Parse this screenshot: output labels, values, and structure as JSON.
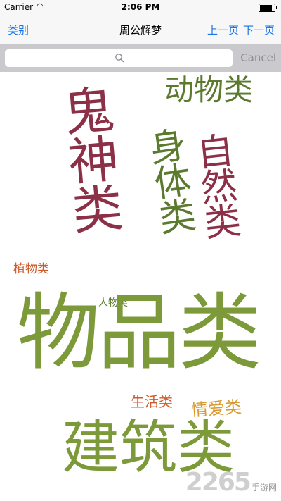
{
  "status": {
    "carrier": "Carrier",
    "time": "2:06 PM"
  },
  "navbar": {
    "left": "类别",
    "title": "周公解梦",
    "prev": "上一页",
    "next": "下一页"
  },
  "search": {
    "placeholder": "",
    "cancel": "Cancel"
  },
  "categories": {
    "animal": "动物类",
    "ghost": "鬼神类",
    "nature": "自然类",
    "body": "身体类",
    "plant": "植物类",
    "person": "人物类",
    "object": "物品类",
    "life": "生活类",
    "love": "情爱类",
    "building": "建筑类"
  },
  "colors": {
    "green": "#5b7a2e",
    "olive": "#7d9a3a",
    "crimson": "#8c3048",
    "orange": "#cf5a2c",
    "gold": "#d79a33",
    "accent": "#1a73e8"
  },
  "watermark": {
    "number": "2265",
    "text": "手游网"
  }
}
